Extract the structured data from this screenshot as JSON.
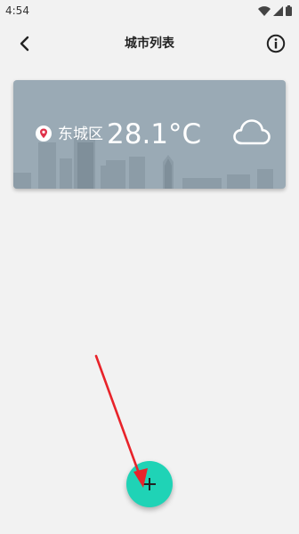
{
  "status_bar": {
    "time": "4:54"
  },
  "header": {
    "title": "城市列表",
    "back_icon": "chevron-left-icon",
    "info_icon": "info-circle-icon"
  },
  "city_card": {
    "district": "东城区",
    "temperature": "28.1°C",
    "weather_icon": "cloud-icon",
    "location_icon": "location-pin-icon",
    "colors": {
      "card_bg": "#9aaab5",
      "pin": "#e0324a"
    }
  },
  "fab": {
    "icon": "plus-icon",
    "color": "#1fd3b6"
  },
  "annotation": {
    "arrow_color": "#e8232a"
  }
}
